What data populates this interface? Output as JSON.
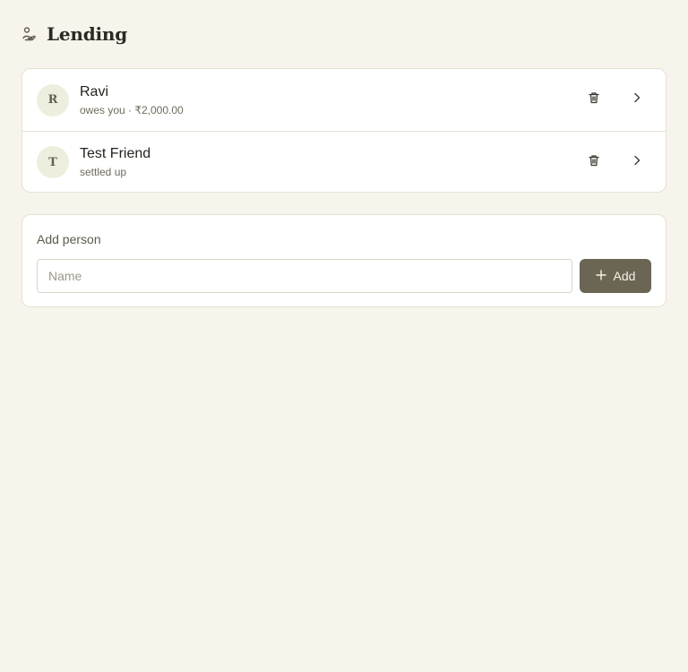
{
  "header": {
    "title": "Lending",
    "icon": "hand-coins-icon"
  },
  "people": [
    {
      "initial": "R",
      "name": "Ravi",
      "status": "owes you · ₹2,000.00"
    },
    {
      "initial": "T",
      "name": "Test Friend",
      "status": "settled up"
    }
  ],
  "add_person": {
    "title": "Add person",
    "name_placeholder": "Name",
    "name_value": "",
    "add_label": "Add"
  },
  "colors": {
    "background": "#f7f4ec",
    "card": "#ffffff",
    "accent": "#6b6654",
    "avatar_bg": "#edeedd"
  }
}
